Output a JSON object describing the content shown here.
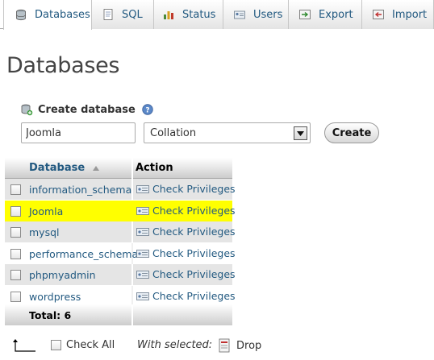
{
  "tabs": [
    {
      "label": "Databases",
      "icon": "databases-icon",
      "active": true
    },
    {
      "label": "SQL",
      "icon": "sql-icon",
      "active": false
    },
    {
      "label": "Status",
      "icon": "status-icon",
      "active": false
    },
    {
      "label": "Users",
      "icon": "users-icon",
      "active": false
    },
    {
      "label": "Export",
      "icon": "export-icon",
      "active": false
    },
    {
      "label": "Import",
      "icon": "import-icon",
      "active": false
    }
  ],
  "page_title": "Databases",
  "create_form": {
    "heading": "Create database",
    "db_name_value": "Joomla",
    "collation_value": "Collation",
    "create_label": "Create"
  },
  "table": {
    "col_database": "Database",
    "col_action": "Action",
    "rows": [
      {
        "name": "information_schema",
        "action": "Check Privileges",
        "highlighted": false
      },
      {
        "name": "Joomla",
        "action": "Check Privileges",
        "highlighted": true
      },
      {
        "name": "mysql",
        "action": "Check Privileges",
        "highlighted": false
      },
      {
        "name": "performance_schema",
        "action": "Check Privileges",
        "highlighted": false
      },
      {
        "name": "phpmyadmin",
        "action": "Check Privileges",
        "highlighted": false
      },
      {
        "name": "wordpress",
        "action": "Check Privileges",
        "highlighted": false
      }
    ],
    "total": "Total: 6"
  },
  "footer": {
    "check_all": "Check All",
    "with_selected": "With selected:",
    "drop": "Drop"
  },
  "colors": {
    "link": "#235a81",
    "highlight": "#ffff00",
    "odd_row": "#e5e5e5"
  }
}
